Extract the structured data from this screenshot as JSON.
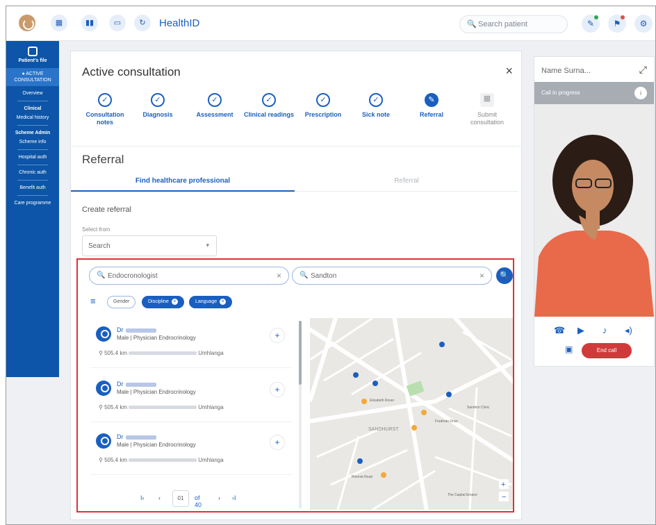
{
  "app": {
    "brand": "HealthID"
  },
  "topbar": {
    "search_placeholder": "Search patient",
    "nav_icons": [
      "calendar-icon",
      "chart-icon",
      "card-icon",
      "refresh-icon"
    ],
    "right_icons": [
      "notes-icon",
      "alert-icon",
      "settings-icon"
    ]
  },
  "sidebar": {
    "patient_file": "Patient's file",
    "active_label": "● ACTIVE CONSULTATION",
    "overview": "Overview",
    "clinical": "Clinical",
    "medical_history": "Medical history",
    "scheme_admin": "Scheme Admin",
    "scheme_info": "Scheme info",
    "hospital_auth": "Hospital auth",
    "chronic_auth": "Chronic auth",
    "benefit_auth": "Benefit auth",
    "care_programme": "Care programme"
  },
  "consultation": {
    "title": "Active consultation",
    "close": "×",
    "steps": [
      {
        "label": "Consultation notes",
        "state": "done"
      },
      {
        "label": "Diagnosis",
        "state": "done"
      },
      {
        "label": "Assessment",
        "state": "done"
      },
      {
        "label": "Clinical readings",
        "state": "done"
      },
      {
        "label": "Prescription",
        "state": "done"
      },
      {
        "label": "Sick note",
        "state": "done"
      },
      {
        "label": "Referral",
        "state": "current"
      },
      {
        "label": "Submit consultation",
        "state": "pending"
      }
    ],
    "section_title": "Referral",
    "tabs": {
      "find": "Find healthcare professional",
      "referral": "Referral"
    },
    "create_referral": "Create referral",
    "select_from_label": "Select from",
    "select_value": "Search"
  },
  "finder": {
    "discipline_query": "Endocronologist",
    "location_query": "Sandton",
    "chips": {
      "gender": "Gender",
      "discipline": "Discipline",
      "language": "Language"
    },
    "results": [
      {
        "prefix": "Dr",
        "spec": "Male | Physician Endrocrinology",
        "dist": "505.4 km",
        "place": "Umhlanga"
      },
      {
        "prefix": "Dr",
        "spec": "Male | Physician Endrocrinology",
        "dist": "505.4 km",
        "place": "Umhlanga"
      },
      {
        "prefix": "Dr",
        "spec": "Male | Physician Endrocrinology",
        "dist": "505.4 km",
        "place": "Umhlanga"
      }
    ],
    "pagination": {
      "first": "I‹",
      "prev": "‹",
      "page": "01",
      "of": "of 40",
      "next": "›",
      "last": "›I"
    },
    "map_label": "SANDHURST",
    "map_places": [
      "Elizabeth Rover",
      "Sandton Clinic",
      "The Capital Empire",
      "Fredman Drive",
      "Rivonia Road"
    ]
  },
  "video": {
    "name": "Name Surna...",
    "status": "Call in progress",
    "end_call": "End call"
  },
  "colors": {
    "primary": "#1a5fc0",
    "sidebar": "#0c55a8",
    "danger": "#d13a3a",
    "highlight": "#e03131"
  }
}
